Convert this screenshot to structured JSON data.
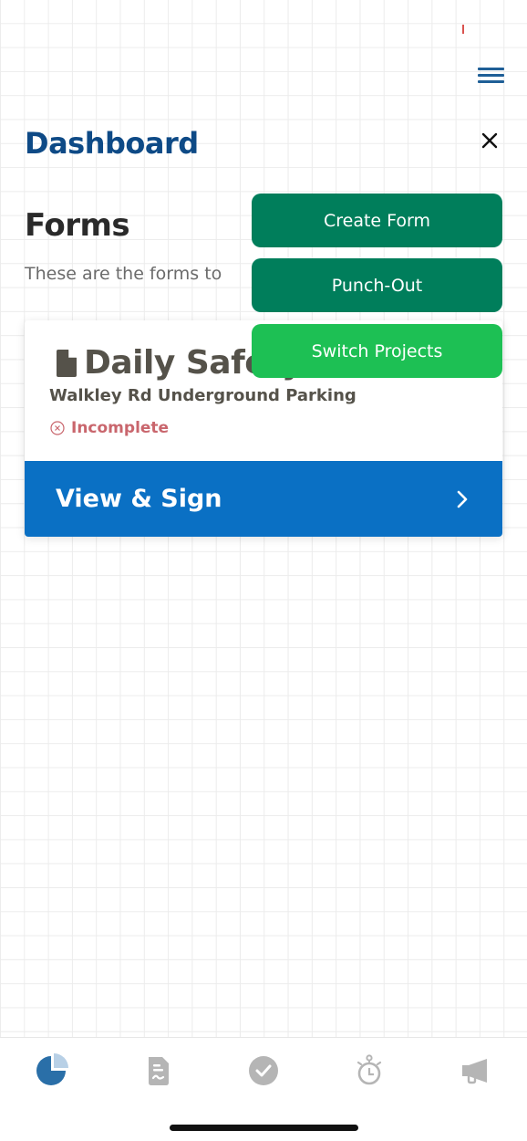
{
  "colors": {
    "title_blue": "#0e4a86",
    "primary_green": "#007e5b",
    "bright_green": "#1dc054",
    "action_blue": "#0a70c4",
    "incomplete_red": "#c9666d",
    "inactive_icon": "#b5b5b5",
    "active_icon": "#2a6fa8"
  },
  "header": {
    "menu_icon": "hamburger-icon",
    "title": "Dashboard",
    "close_icon": "close-icon"
  },
  "forms_section": {
    "title": "Forms",
    "description": "These are the forms to"
  },
  "menu_actions": [
    {
      "label": "Create Form"
    },
    {
      "label": "Punch-Out"
    },
    {
      "label": "Switch Projects"
    }
  ],
  "form_card": {
    "icon": "document-icon",
    "title": "Daily Safety",
    "project": "Walkley Rd Underground Parking",
    "status_icon": "x-circle-icon",
    "status": "Incomplete",
    "action_label": "View & Sign",
    "action_icon": "chevron-right-icon"
  },
  "tabbar": {
    "items": [
      {
        "name": "dashboard",
        "icon": "pie-chart-icon",
        "active": true
      },
      {
        "name": "forms",
        "icon": "signed-document-icon",
        "active": false
      },
      {
        "name": "tasks",
        "icon": "check-circle-icon",
        "active": false
      },
      {
        "name": "timesheet",
        "icon": "stopwatch-icon",
        "active": false
      },
      {
        "name": "announcements",
        "icon": "megaphone-icon",
        "active": false
      }
    ]
  }
}
